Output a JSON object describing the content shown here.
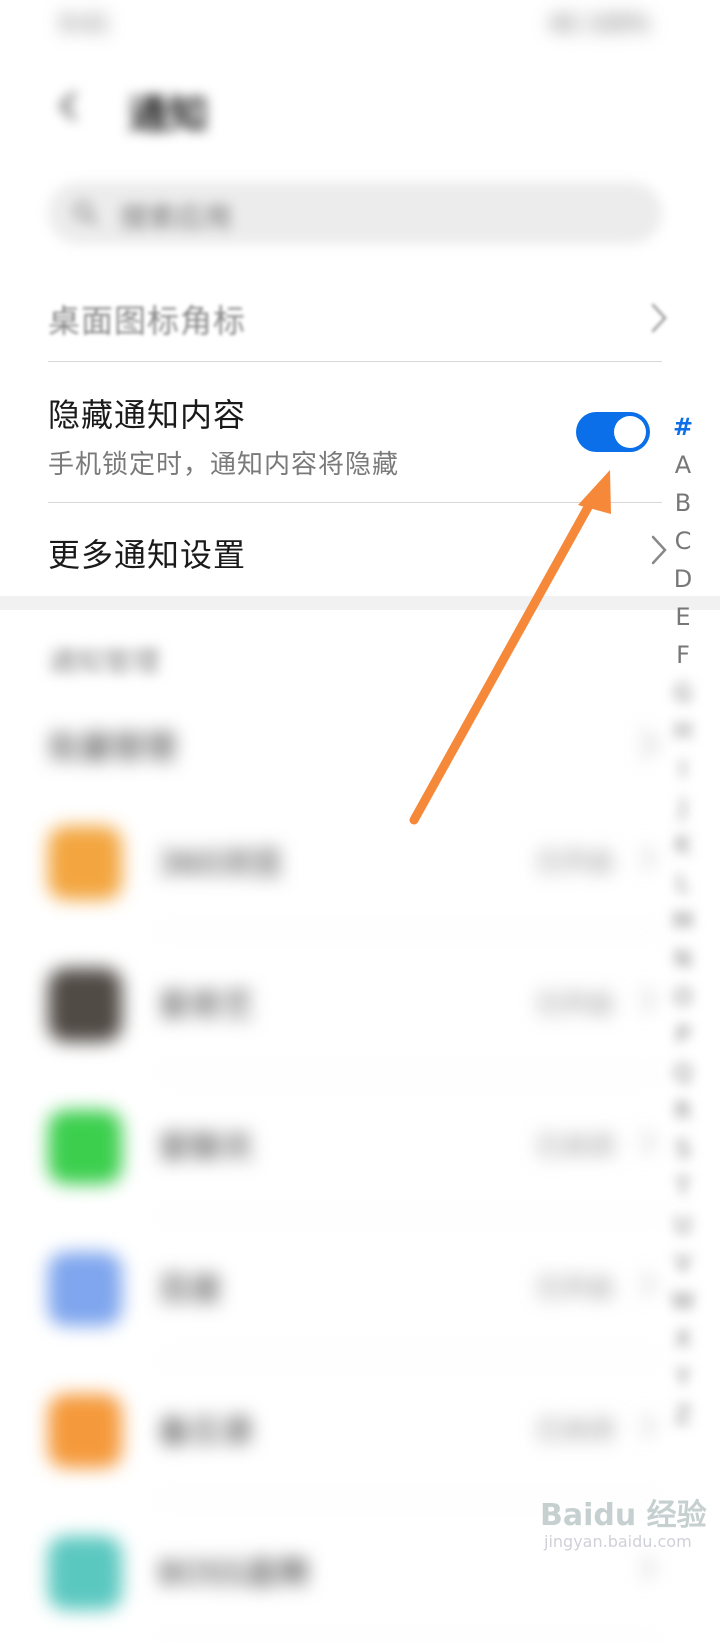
{
  "status_bar": {
    "left": "9:41",
    "right": "4G 100%"
  },
  "header": {
    "title": "通知"
  },
  "search": {
    "placeholder": "搜索应用"
  },
  "settings": {
    "badges": {
      "label": "桌面图标角标"
    },
    "hide_content": {
      "label": "隐藏通知内容",
      "sublabel": "手机锁定时，通知内容将隐藏",
      "enabled": true
    },
    "more": {
      "label": "更多通知设置"
    }
  },
  "notification_management": {
    "section_label": "通知管理",
    "batch_label": "批量管理",
    "apps": [
      {
        "name": "360浏览",
        "status": "已开启",
        "icon_color": "#f3a640"
      },
      {
        "name": "爱奇艺",
        "status": "已开启",
        "icon_color": "#514b46"
      },
      {
        "name": "爱聊天",
        "status": "已关闭",
        "icon_color": "#3ccf4e"
      },
      {
        "name": "百度",
        "status": "已开启",
        "icon_color": "#7fa6ee"
      },
      {
        "name": "备忘录",
        "status": "已关闭",
        "icon_color": "#f59a3c"
      },
      {
        "name": "BOSS直聘",
        "status": "",
        "icon_color": "#5bc8c0"
      }
    ]
  },
  "index_bar": {
    "active": "#",
    "letters": [
      "A",
      "B",
      "C",
      "D",
      "E",
      "F",
      "G",
      "H",
      "I",
      "J",
      "K",
      "L",
      "M",
      "N",
      "O",
      "P",
      "Q",
      "R",
      "S",
      "T",
      "U",
      "V",
      "W",
      "X",
      "Y",
      "Z"
    ]
  },
  "watermark": {
    "text": "Baidu 经验",
    "url": "jingyan.baidu.com"
  },
  "colors": {
    "accent": "#0a6fe8",
    "arrow": "#f6883a"
  }
}
